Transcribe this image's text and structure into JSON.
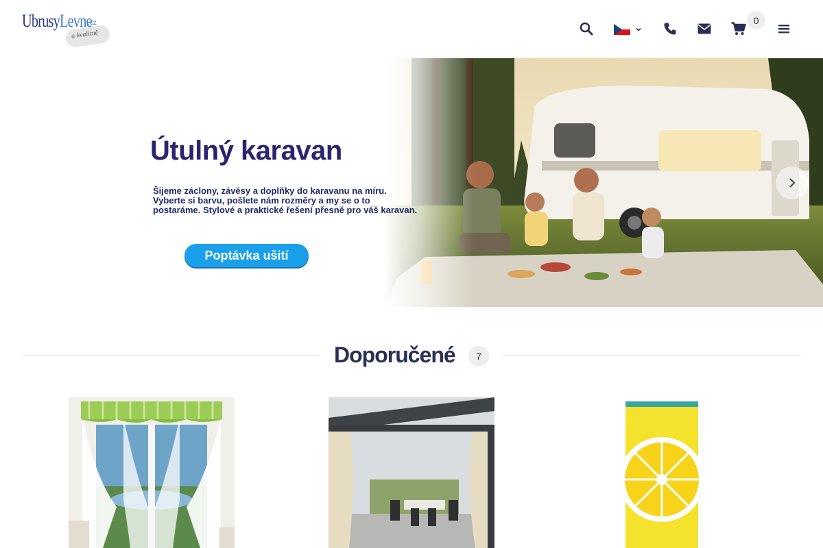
{
  "header": {
    "logo": {
      "main_part1": "Ubrusy",
      "main_part2": "Levne",
      "tld": ".cz",
      "tagline": "a kvalitně"
    },
    "icons": {
      "search": "search-icon",
      "language": "czech-flag-icon",
      "phone": "phone-icon",
      "email": "envelope-icon",
      "cart": "cart-icon",
      "menu": "hamburger-menu-icon"
    },
    "cart_count": "0"
  },
  "hero": {
    "title": "Útulný karavan",
    "text_line1": "Šijeme záclony, závěsy a doplňky do karavanu na míru.",
    "text_line2": "Vyberte si barvu, pošlete nám rozměry a my se o to",
    "text_line3": "postaráme. Stylové a praktické řešení přesně pro váš karavan.",
    "cta_label": "Poptávka ušití",
    "next_icon": "chevron-right-icon"
  },
  "section": {
    "title": "Doporučené",
    "count": "7"
  },
  "products": [
    {
      "image": "window-curtain-green-gingham"
    },
    {
      "image": "pergola-beige-curtains"
    },
    {
      "image": "yellow-lemon-beach-towel"
    }
  ],
  "colors": {
    "brand_dark": "#2a2570",
    "accent_blue": "#1aa0ea",
    "heading": "#2b2f55"
  }
}
